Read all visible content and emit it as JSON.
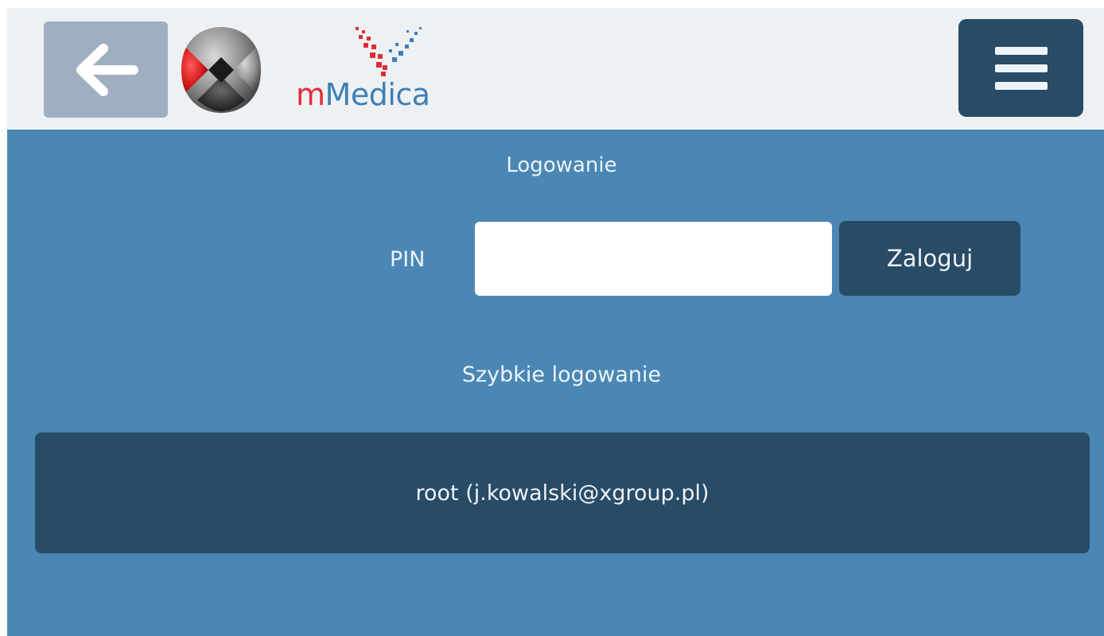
{
  "header": {
    "back_icon": "arrow-left-icon",
    "brand_logo": "x-group-logo",
    "app_logo_m": "m",
    "app_logo_rest": "Medica",
    "menu_icon": "hamburger-menu-icon"
  },
  "login": {
    "heading": "Logowanie",
    "pin_label": "PIN",
    "pin_value": "",
    "pin_placeholder": "",
    "submit_label": "Zaloguj"
  },
  "quick_login": {
    "heading": "Szybkie logowanie",
    "users": [
      {
        "label": "root (j.kowalski@xgroup.pl)"
      }
    ]
  },
  "colors": {
    "header_bg": "#eef1f4",
    "main_bg": "#4b87b4",
    "dark_button": "#284b66",
    "back_button": "#a0afbf",
    "logo_red": "#e32b35",
    "logo_blue": "#3f7fb5"
  }
}
